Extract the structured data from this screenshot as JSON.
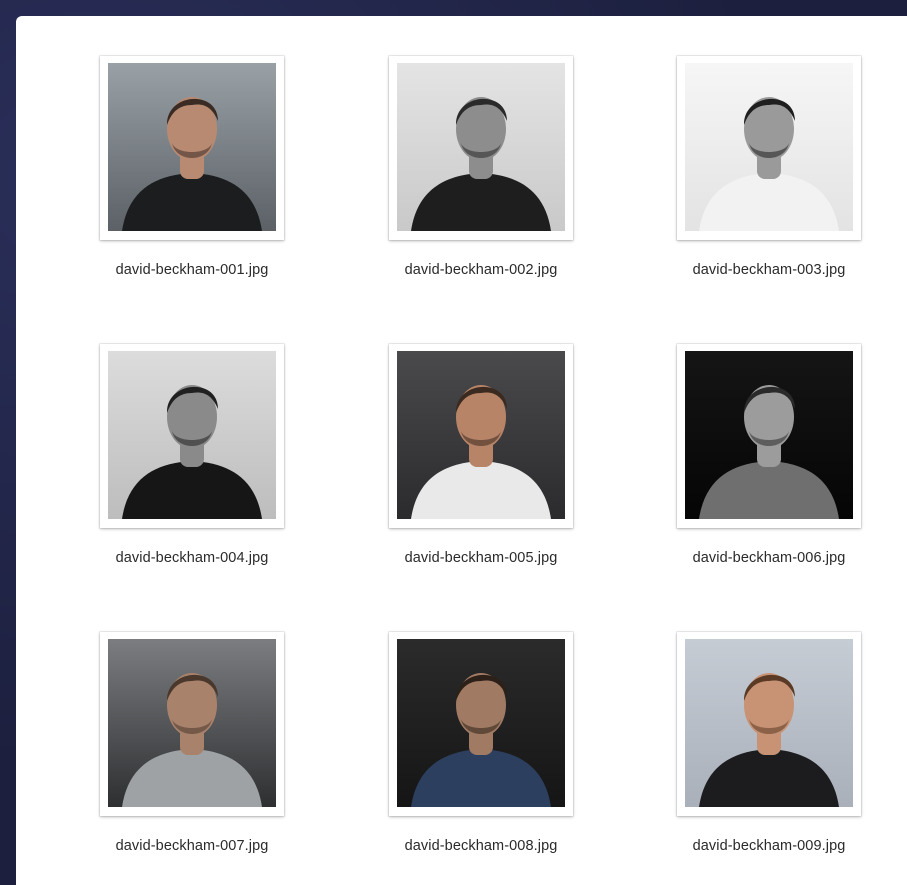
{
  "files": [
    {
      "name": "david-beckham-001.jpg",
      "palette": {
        "bg1": "#9aa1a6",
        "bg2": "#5b6166",
        "shirt": "#1c1d1f",
        "skin": "#b98a72",
        "hair": "#3a2c24"
      }
    },
    {
      "name": "david-beckham-002.jpg",
      "palette": {
        "bg1": "#e4e4e4",
        "bg2": "#c9c9c9",
        "shirt": "#1e1e1e",
        "skin": "#8d8d8d",
        "hair": "#2a2a2a"
      }
    },
    {
      "name": "david-beckham-003.jpg",
      "palette": {
        "bg1": "#f6f6f6",
        "bg2": "#e3e3e3",
        "shirt": "#f2f2f2",
        "skin": "#9a9a9a",
        "hair": "#1f1f1f"
      }
    },
    {
      "name": "david-beckham-004.jpg",
      "palette": {
        "bg1": "#dcdcdc",
        "bg2": "#bdbdbd",
        "shirt": "#161616",
        "skin": "#8a8a8a",
        "hair": "#202020"
      }
    },
    {
      "name": "david-beckham-005.jpg",
      "palette": {
        "bg1": "#4a4a4c",
        "bg2": "#2b2b2d",
        "shirt": "#e9e9e9",
        "skin": "#b78467",
        "hair": "#3b2a1f"
      }
    },
    {
      "name": "david-beckham-006.jpg",
      "palette": {
        "bg1": "#151515",
        "bg2": "#050505",
        "shirt": "#6f6f6f",
        "skin": "#9c9c9c",
        "hair": "#2a2a2a"
      }
    },
    {
      "name": "david-beckham-007.jpg",
      "palette": {
        "bg1": "#7b7d80",
        "bg2": "#2e2f31",
        "shirt": "#9ea2a5",
        "skin": "#a9826c",
        "hair": "#4a382c"
      }
    },
    {
      "name": "david-beckham-008.jpg",
      "palette": {
        "bg1": "#2b2b2b",
        "bg2": "#151515",
        "shirt": "#2d3f5e",
        "skin": "#a07a63",
        "hair": "#2c2018"
      }
    },
    {
      "name": "david-beckham-009.jpg",
      "palette": {
        "bg1": "#c6ccd4",
        "bg2": "#a9b0ba",
        "shirt": "#1c1c1e",
        "skin": "#c89274",
        "hair": "#5a3a24"
      }
    }
  ]
}
